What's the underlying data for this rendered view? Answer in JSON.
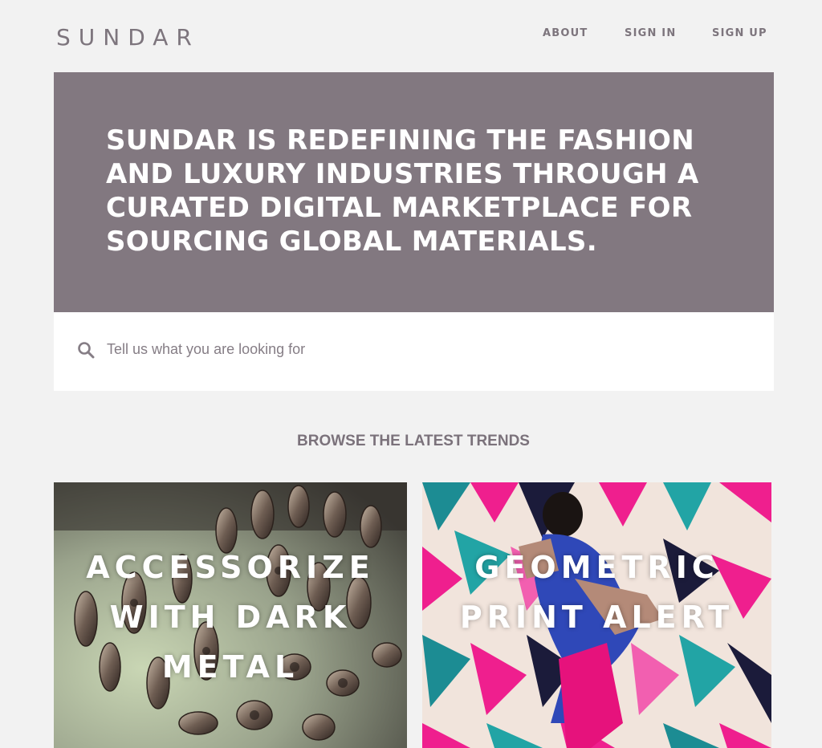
{
  "header": {
    "logo": "SUNDAR",
    "nav": [
      {
        "label": "ABOUT"
      },
      {
        "label": "SIGN IN"
      },
      {
        "label": "SIGN UP"
      }
    ]
  },
  "hero": {
    "title": "SUNDAR IS REDEFINING THE FASHION AND LUXURY INDUSTRIES THROUGH A CURATED DIGITAL MARKETPLACE FOR SOURCING GLOBAL MATERIALS."
  },
  "search": {
    "icon": "search-icon",
    "placeholder": "Tell us what you are looking for",
    "value": ""
  },
  "trends": {
    "title": "BROWSE THE LATEST TRENDS",
    "cards": [
      {
        "title": "ACCESSORIZE WITH DARK METAL"
      },
      {
        "title": "GEOMETRIC PRINT ALERT"
      }
    ]
  },
  "colors": {
    "background": "#f2f2f2",
    "hero": "#827880",
    "text": "#7b727b"
  }
}
